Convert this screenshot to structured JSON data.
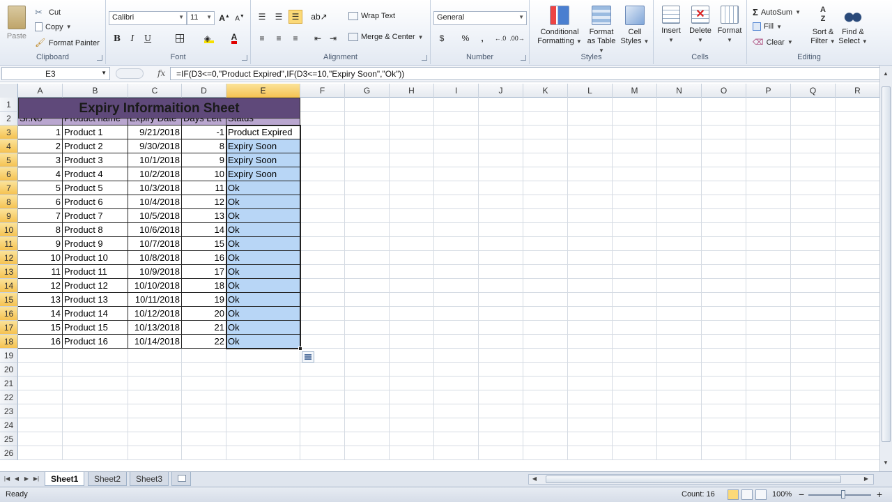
{
  "ribbon": {
    "clipboard": {
      "paste": "Paste",
      "cut": "Cut",
      "copy": "Copy",
      "format_painter": "Format Painter",
      "label": "Clipboard"
    },
    "font": {
      "name": "Calibri",
      "size": "11",
      "bold": "B",
      "italic": "I",
      "underline": "U",
      "label": "Font"
    },
    "alignment": {
      "wrap_text": "Wrap Text",
      "merge_center": "Merge & Center",
      "label": "Alignment"
    },
    "number": {
      "format": "General",
      "currency": "$",
      "percent": "%",
      "comma": ",",
      "label": "Number"
    },
    "styles": {
      "conditional": "Conditional",
      "conditional2": "Formatting",
      "format_table": "Format",
      "format_table2": "as Table",
      "cell_styles": "Cell",
      "cell_styles2": "Styles",
      "label": "Styles"
    },
    "cells": {
      "insert": "Insert",
      "delete": "Delete",
      "format": "Format",
      "label": "Cells"
    },
    "editing": {
      "autosum": "AutoSum",
      "fill": "Fill",
      "clear": "Clear",
      "sort": "Sort &",
      "sort2": "Filter",
      "find": "Find &",
      "find2": "Select",
      "label": "Editing"
    }
  },
  "formula_bar": {
    "name_box": "E3",
    "fx": "fx",
    "formula": "=IF(D3<=0,\"Product Expired\",IF(D3<=10,\"Expiry Soon\",\"Ok\"))"
  },
  "columns": [
    "A",
    "B",
    "C",
    "D",
    "E",
    "F",
    "G",
    "H",
    "I",
    "J",
    "K",
    "L",
    "M",
    "N",
    "O",
    "P",
    "Q",
    "R"
  ],
  "rows": [
    "1",
    "2",
    "3",
    "4",
    "5",
    "6",
    "7",
    "8",
    "9",
    "10",
    "11",
    "12",
    "13",
    "14",
    "15",
    "16",
    "17",
    "18",
    "19",
    "20",
    "21",
    "22",
    "23",
    "24",
    "25",
    "26"
  ],
  "sheet": {
    "title": "Expiry Informaition Sheet",
    "headers": [
      "Sr.No",
      "Product name",
      "Expiry Date",
      "Days Left",
      "Status"
    ],
    "data": [
      [
        "1",
        "Product 1",
        "9/21/2018",
        "-1",
        "Product Expired"
      ],
      [
        "2",
        "Product 2",
        "9/30/2018",
        "8",
        "Expiry Soon"
      ],
      [
        "3",
        "Product 3",
        "10/1/2018",
        "9",
        "Expiry Soon"
      ],
      [
        "4",
        "Product 4",
        "10/2/2018",
        "10",
        "Expiry Soon"
      ],
      [
        "5",
        "Product 5",
        "10/3/2018",
        "11",
        "Ok"
      ],
      [
        "6",
        "Product 6",
        "10/4/2018",
        "12",
        "Ok"
      ],
      [
        "7",
        "Product 7",
        "10/5/2018",
        "13",
        "Ok"
      ],
      [
        "8",
        "Product 8",
        "10/6/2018",
        "14",
        "Ok"
      ],
      [
        "9",
        "Product 9",
        "10/7/2018",
        "15",
        "Ok"
      ],
      [
        "10",
        "Product 10",
        "10/8/2018",
        "16",
        "Ok"
      ],
      [
        "11",
        "Product 11",
        "10/9/2018",
        "17",
        "Ok"
      ],
      [
        "12",
        "Product 12",
        "10/10/2018",
        "18",
        "Ok"
      ],
      [
        "13",
        "Product 13",
        "10/11/2018",
        "19",
        "Ok"
      ],
      [
        "14",
        "Product 14",
        "10/12/2018",
        "20",
        "Ok"
      ],
      [
        "15",
        "Product 15",
        "10/13/2018",
        "21",
        "Ok"
      ],
      [
        "16",
        "Product 16",
        "10/14/2018",
        "22",
        "Ok"
      ]
    ]
  },
  "tabs": [
    "Sheet1",
    "Sheet2",
    "Sheet3"
  ],
  "status": {
    "ready": "Ready",
    "count": "Count: 16",
    "zoom": "100%"
  },
  "colors": {
    "title_bg": "#5f497a",
    "header_bg": "#b9a6cf",
    "selection": "#b8d6f6",
    "active_header": "#f5c251"
  }
}
